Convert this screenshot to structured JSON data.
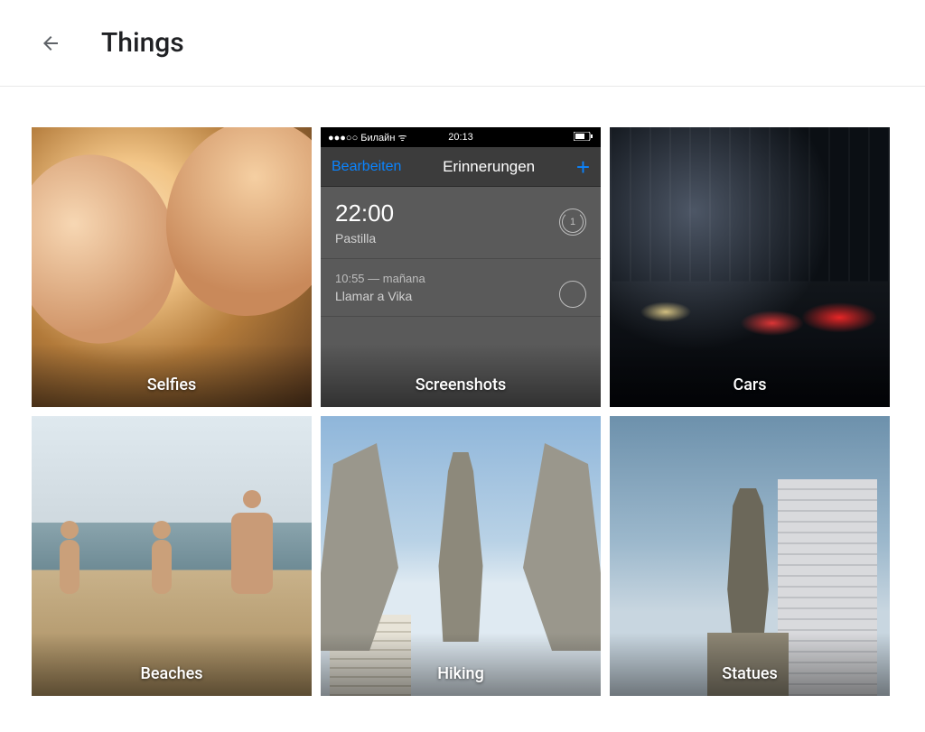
{
  "header": {
    "title": "Things",
    "back_icon": "arrow-back"
  },
  "categories": [
    {
      "label": "Selfies"
    },
    {
      "label": "Screenshots"
    },
    {
      "label": "Cars"
    },
    {
      "label": "Beaches"
    },
    {
      "label": "Hiking"
    },
    {
      "label": "Statues"
    }
  ],
  "screenshot_preview": {
    "status_left": "●●●○○ Билайн ᯤ",
    "status_time": "20:13",
    "status_right_icon": "battery",
    "nav_left": "Bearbeiten",
    "nav_title": "Erinnerungen",
    "nav_right_icon": "plus",
    "items": [
      {
        "time": "22:00",
        "title": "Pastilla",
        "accessory": "repeat",
        "accessory_text": "1"
      },
      {
        "line2": "10:55 — mañana",
        "title": "Llamar a Vika",
        "accessory": "circle"
      }
    ]
  }
}
